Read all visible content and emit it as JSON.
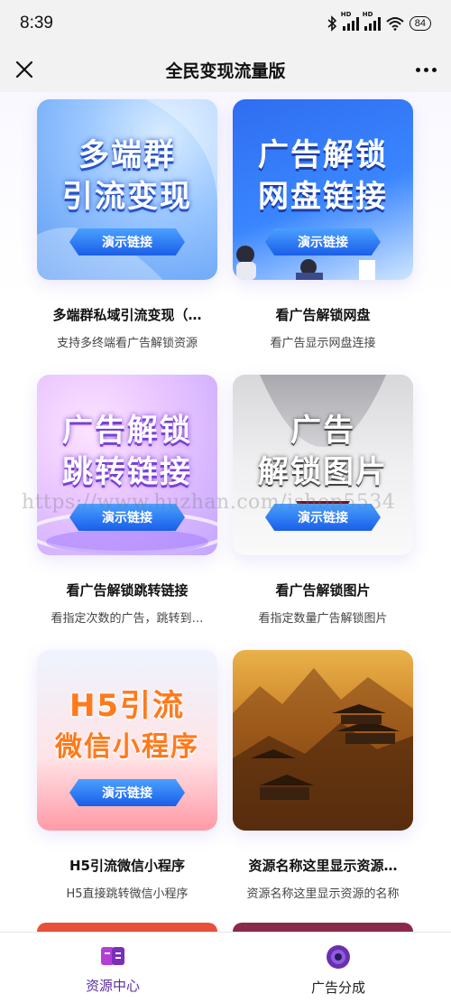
{
  "status": {
    "time": "8:39",
    "battery": "84",
    "net1": "HD",
    "net2": "HD"
  },
  "nav": {
    "title": "全民变现流量版"
  },
  "watermark": "https://www.huzhan.com/ishop5534",
  "cards": [
    {
      "banner_line1": "多端群",
      "banner_line2": "引流变现",
      "button": "演示链接",
      "title": "多端群私域引流变现（…",
      "desc": "支持多终端看广告解锁资源"
    },
    {
      "banner_line1": "广告解锁",
      "banner_line2": "网盘链接",
      "button": "演示链接",
      "title": "看广告解锁网盘",
      "desc": "看广告显示网盘连接"
    },
    {
      "banner_line1": "广告解锁",
      "banner_line2": "跳转链接",
      "button": "演示链接",
      "title": "看广告解锁跳转链接",
      "desc": "看指定次数的广告，跳转到…"
    },
    {
      "banner_line1": "广告",
      "banner_line2": "解锁图片",
      "button": "演示链接",
      "title": "看广告解锁图片",
      "desc": "看指定数量广告解锁图片"
    },
    {
      "banner_line1": "H5引流",
      "banner_line2": "微信小程序",
      "button": "演示链接",
      "title": "H5引流微信小程序",
      "desc": "H5直接跳转微信小程序"
    },
    {
      "title": "资源名称这里显示资源…",
      "desc": "资源名称这里显示资源的名称"
    }
  ],
  "tabs": [
    {
      "label": "资源中心",
      "icon": "resource-center-icon",
      "active": true
    },
    {
      "label": "广告分成",
      "icon": "ad-share-icon",
      "active": false
    }
  ],
  "colors": {
    "accent": "#5b2f9e",
    "button": "#1a5ee8"
  }
}
